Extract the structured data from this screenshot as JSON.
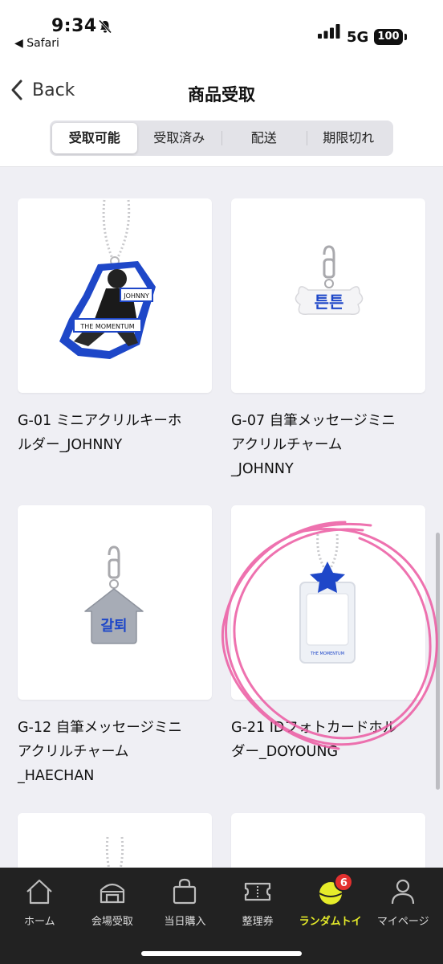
{
  "status_bar": {
    "time": "9:34",
    "back_app": "◀ Safari",
    "network": "5G",
    "battery": "100"
  },
  "nav": {
    "back_label": "Back",
    "title": "商品受取"
  },
  "segments": [
    {
      "label": "受取可能",
      "active": true
    },
    {
      "label": "受取済み",
      "active": false
    },
    {
      "label": "配送",
      "active": false
    },
    {
      "label": "期限切れ",
      "active": false
    }
  ],
  "products": [
    {
      "name_lines": [
        "G-01 ミニアクリルキーホ",
        "ルダー_JOHNNY"
      ],
      "image_text": [
        "JOHNNY",
        "THE MOMENTUM"
      ]
    },
    {
      "name_lines": [
        "G-07 自筆メッセージミニ",
        "アクリルチャーム",
        "_JOHNNY"
      ],
      "image_text": [
        "튼튼"
      ]
    },
    {
      "name_lines": [
        "G-12 自筆メッセージミニ",
        "アクリルチャーム",
        "_HAECHAN"
      ],
      "image_text": [
        "갈퇴"
      ]
    },
    {
      "name_lines": [
        "G-21 IDフォトカードホル",
        "ダー_DOYOUNG"
      ],
      "image_text": [
        "THE MOMENTUM"
      ]
    }
  ],
  "tabs": [
    {
      "label": "ホーム",
      "icon": "home-icon"
    },
    {
      "label": "会場受取",
      "icon": "venue-icon"
    },
    {
      "label": "当日購入",
      "icon": "shopping-bag-icon"
    },
    {
      "label": "整理券",
      "icon": "ticket-icon"
    },
    {
      "label": "ランダムトイ",
      "icon": "random-toy-icon",
      "active": true,
      "badge": "6"
    },
    {
      "label": "マイページ",
      "icon": "person-icon"
    }
  ],
  "colors": {
    "accent": "#e6ec2a",
    "badge": "#e2302f",
    "tab_bg": "#222222",
    "annotation": "#ec5aa2",
    "charm_blue": "#1e47c8"
  }
}
